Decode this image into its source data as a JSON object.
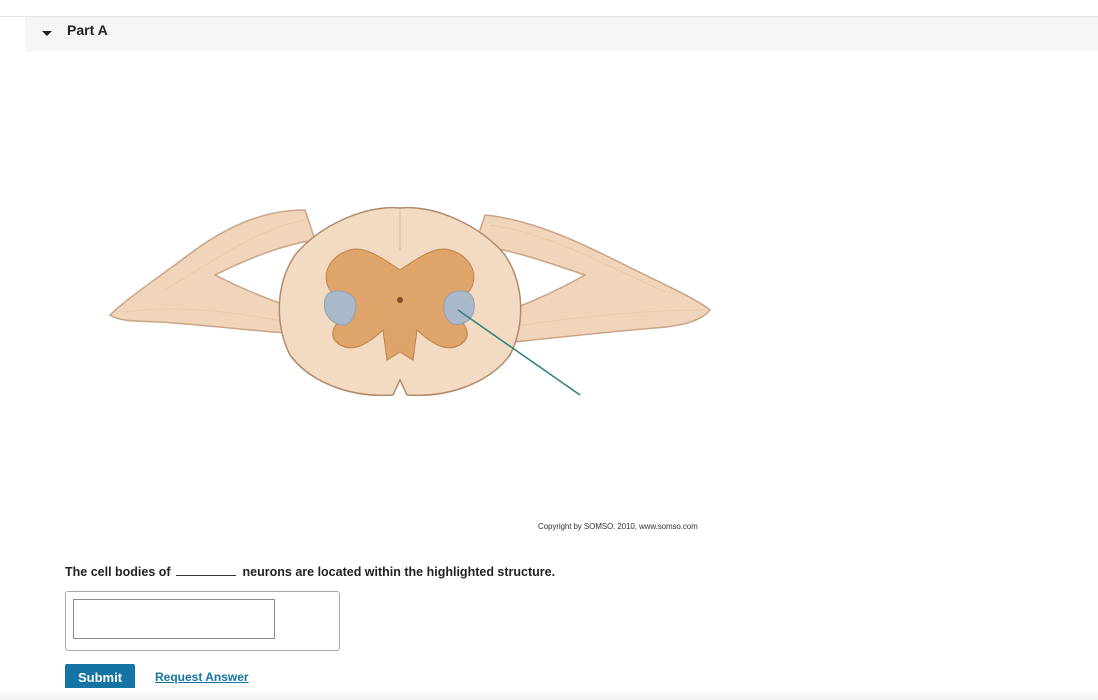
{
  "part": {
    "title": "Part A",
    "toggle_icon": "caret-down-icon"
  },
  "figure": {
    "subject": "spinal cord cross-section with highlighted structure",
    "copyright": "Copyright by SOMSO. 2010, www.somso.com",
    "colors": {
      "nerve": "#f3d7bd",
      "white_matter": "#f4dcc4",
      "gray_matter": "#dea56a",
      "highlight": "#a8b8c8",
      "pointer_line": "#2b8080"
    }
  },
  "question": {
    "prefix": "The cell bodies of",
    "suffix": "neurons are located within the highlighted structure."
  },
  "answer": {
    "value": "",
    "placeholder": ""
  },
  "actions": {
    "submit_label": "Submit",
    "request_label": "Request Answer",
    "accent_color": "#1474a4"
  }
}
